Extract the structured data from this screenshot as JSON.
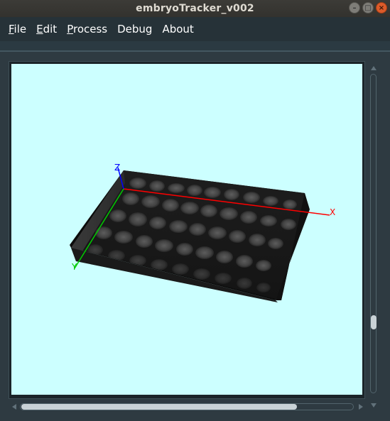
{
  "window": {
    "title": "embryoTracker_v002",
    "controls": [
      "minimize-icon",
      "maximize-icon",
      "close-icon"
    ]
  },
  "menubar": {
    "items": [
      {
        "label": "File",
        "mnemonic": "F",
        "rest": "ile"
      },
      {
        "label": "Edit",
        "mnemonic": "E",
        "rest": "dit"
      },
      {
        "label": "Process",
        "mnemonic": "P",
        "rest": "rocess"
      },
      {
        "label": "Debug",
        "mnemonic": "",
        "rest": "Debug"
      },
      {
        "label": "About",
        "mnemonic": "",
        "rest": "About"
      }
    ]
  },
  "viewer": {
    "background_color": "#ccffff",
    "axes": {
      "x_label": "X",
      "x_color": "#ff0000",
      "y_label": "Y",
      "y_color": "#00cc00",
      "z_label": "Z",
      "z_color": "#0000ff"
    }
  },
  "colors": {
    "menubar": "#263238",
    "titlebar": "#3c3b37"
  }
}
